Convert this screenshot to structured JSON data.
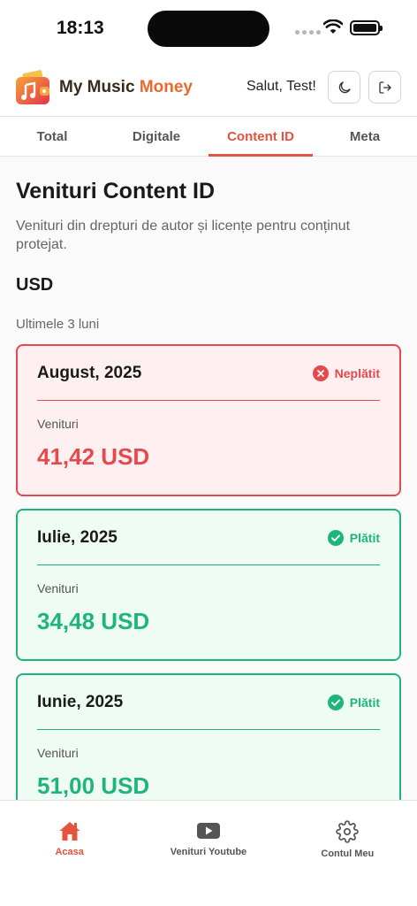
{
  "status_bar": {
    "time": "18:13"
  },
  "header": {
    "brand_main": "My Music ",
    "brand_accent": "Money",
    "greeting": "Salut, Test!",
    "icons": {
      "logo": "music-wallet-logo",
      "theme": "moon-icon",
      "logout": "logout-icon"
    }
  },
  "tabs": [
    {
      "label": "Total",
      "active": false
    },
    {
      "label": "Digitale",
      "active": false
    },
    {
      "label": "Content ID",
      "active": true
    },
    {
      "label": "Meta",
      "active": false
    }
  ],
  "page": {
    "title": "Venituri Content ID",
    "subtitle": "Venituri din drepturi de autor și licențe pentru conținut protejat.",
    "currency": "USD",
    "period": "Ultimele 3 luni"
  },
  "cards": [
    {
      "month": "August, 2025",
      "status": "Neplătit",
      "state": "unpaid",
      "label": "Venituri",
      "amount": "41,42 USD"
    },
    {
      "month": "Iulie, 2025",
      "status": "Plătit",
      "state": "paid",
      "label": "Venituri",
      "amount": "34,48 USD"
    },
    {
      "month": "Iunie, 2025",
      "status": "Plătit",
      "state": "paid",
      "label": "Venituri",
      "amount": "51,00 USD"
    }
  ],
  "bottom_nav": [
    {
      "label": "Acasa",
      "icon": "home-icon",
      "active": true
    },
    {
      "label": "Venituri Youtube",
      "icon": "youtube-icon",
      "active": false
    },
    {
      "label": "Contul Meu",
      "icon": "gear-icon",
      "active": false
    }
  ],
  "colors": {
    "accent": "#e5533d",
    "unpaid": "#e5484d",
    "paid": "#1eb57d",
    "brand_orange": "#ea6a2c"
  }
}
